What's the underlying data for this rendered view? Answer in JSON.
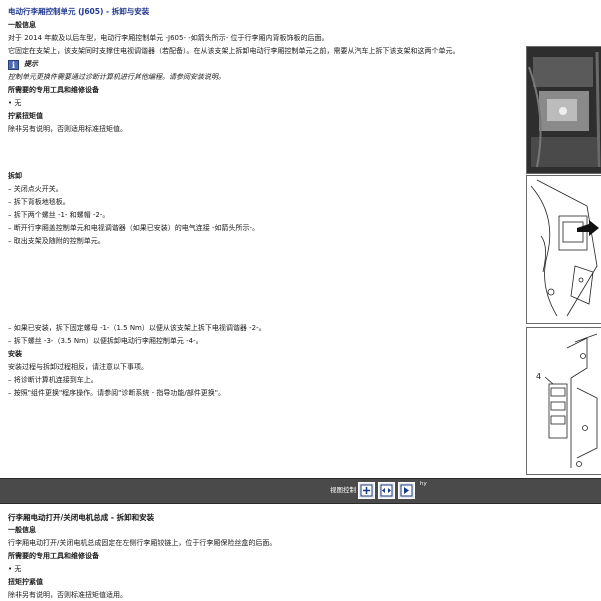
{
  "section1": {
    "title": "电动行李厢控制单元 (J605) - 拆卸与安装",
    "general_heading": "一般信息",
    "general_p1": "对于 2014 年款及以后车型，电动行李厢控制单元 -J605- -如箭头所示- 位于行李厢内背板饰板的后面。",
    "general_p2": "它固定在支架上，该支架同时支撑住电视调谐器（若配备）。在从该支架上拆卸电动行李厢控制单元之前，需要从汽车上拆下该支架和这两个单元。",
    "note_label": "提示",
    "note_text": "控制单元更换件需要通过诊断计算机进行其他编程。请参阅安装说明。",
    "tools_heading": "所需要的专用工具和维修设备",
    "tools_item": "无",
    "torque_heading": "拧紧扭矩值",
    "torque_text": "除非另有说明，否则适用标准扭矩值。",
    "removal_heading": "拆卸",
    "removal_steps": [
      "– 关闭点火开关。",
      "– 拆下背板地毯板。",
      "– 拆下两个螺丝 -1- 和螺帽 -2-。",
      "– 断开行李厢盖控制单元和电视调谐器（如果已安装）的电气连接 -如箭头所示-。",
      "– 取出支架及随附的控制单元。"
    ],
    "removal_steps2": [
      "– 如果已安装，拆下固定螺母 -1-（1.5 Nm）以便从该支架上拆下电视调谐器 -2-。",
      "– 拆下螺丝 -3-（3.5 Nm）以便拆卸电动行李厢控制单元 -4-。"
    ],
    "install_heading": "安装",
    "install_steps": [
      "安装过程与拆卸过程相反，请注意以下事项。",
      "– 将诊断计算机连接到车上。",
      "– 按照\"组件更换\"程序操作。请参阅\"诊断系统 - 指导功能/部件更换\"。"
    ],
    "figure3_callout": "4"
  },
  "toolbar": {
    "zoom_label": "视图控制",
    "hy": "hy"
  },
  "section2": {
    "title": "行李厢电动打开/关闭电机总成 - 拆卸和安装",
    "general_heading": "一般信息",
    "general_p1": "行李厢电动打开/关闭电机总成固定在左侧行李厢铰链上，位于行李厢保险丝盒的后面。",
    "tools_heading": "所需要的专用工具和维修设备",
    "tools_item": "无",
    "torque_heading": "扭矩拧紧值",
    "torque_text": "除非另有说明，否则标准扭矩值适用。"
  }
}
